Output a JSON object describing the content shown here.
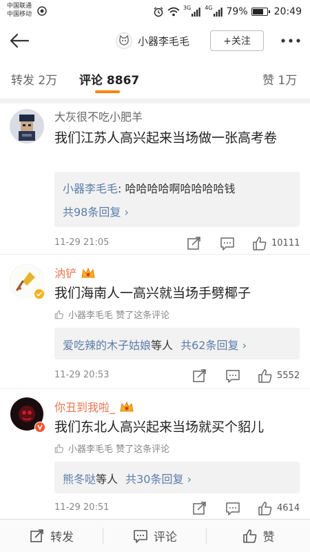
{
  "status_bar": {
    "carrier1": "中国联通",
    "carrier2": "中国移动",
    "net1": "3G",
    "net2": "4G",
    "battery": "79%",
    "battery_level": 0.79,
    "time": "20:49"
  },
  "header": {
    "title": "小器李毛毛",
    "follow_label": "+关注",
    "icons": {
      "back": "back-arrow-icon",
      "more": "more-dots-icon"
    }
  },
  "tabs": {
    "repost": "转发 2万",
    "comment": "评论 8867",
    "like": "赞 1万",
    "accent": "#ff8200"
  },
  "comments": [
    {
      "name": "大灰很不吃小肥羊",
      "text": "我们江苏人高兴起来当场做一张高考卷",
      "reply_author": "小器李毛毛",
      "reply_text": ": 哈哈哈哈啊哈哈哈哈钱",
      "reply_count": "共98条回复 ›",
      "time": "11-29 21:05",
      "likes": "10111"
    },
    {
      "name": "汭铲",
      "text": "我们海南人一高兴就当场手劈椰子",
      "liked_by": "小器李毛毛 赞了这条评论",
      "reply_author": "爱吃辣的木子姑娘",
      "reply_mid": "等人",
      "reply_count": "共62条回复 ›",
      "time": "11-29 20:53",
      "likes": "5552"
    },
    {
      "name": "你丑到我啦_",
      "text": "我们东北人高兴起来当场就买个貂儿",
      "liked_by": "小器李毛毛 赞了这条评论",
      "reply_author": "熊冬哒",
      "reply_mid": "等人",
      "reply_count": "共30条回复 ›",
      "time": "11-29 20:51",
      "likes": "4614"
    }
  ],
  "bottom_bar": {
    "repost": "转发",
    "comment": "评论",
    "like": "赞"
  },
  "colors": {
    "link": "#5b7cab",
    "name_orange": "#eb7350"
  }
}
